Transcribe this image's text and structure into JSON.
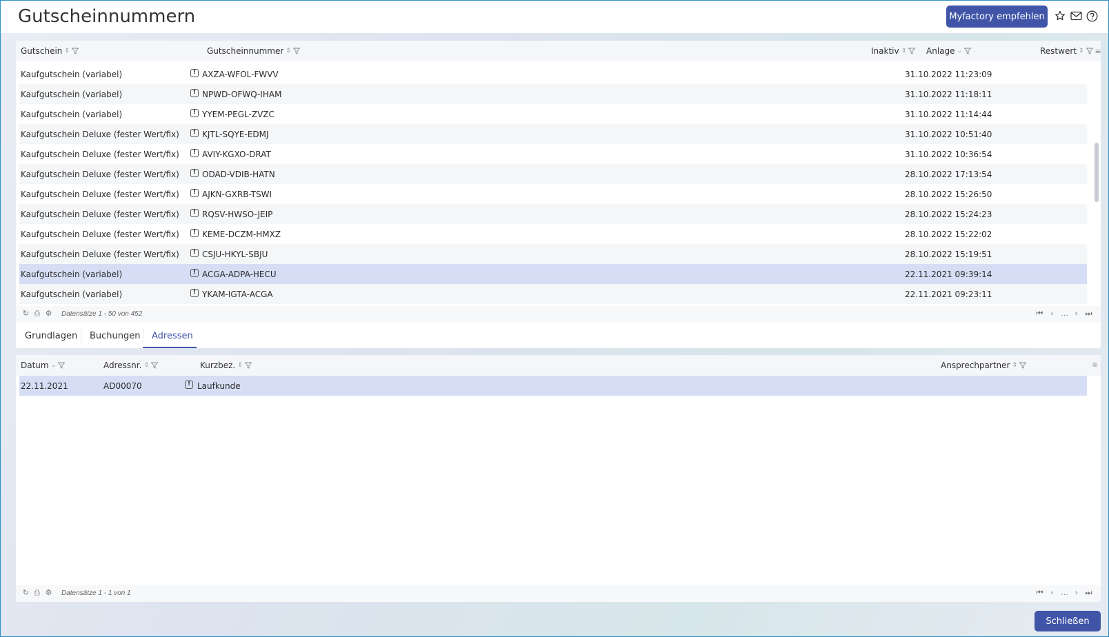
{
  "header": {
    "title": "Gutscheinnummern",
    "recommend_label": "Myfactory empfehlen",
    "icons": [
      "star-icon",
      "mail-icon",
      "help-icon"
    ]
  },
  "main_grid": {
    "columns": [
      "Gutschein",
      "Gutscheinnummer",
      "Inaktiv",
      "Anlage",
      "Restwert"
    ],
    "rows": [
      {
        "gutschein": "Kaufgutschein (variabel)",
        "nummer": "AXZA-WFOL-FWVV",
        "anlage": "31.10.2022 11:23:09"
      },
      {
        "gutschein": "Kaufgutschein (variabel)",
        "nummer": "NPWD-OFWQ-IHAM",
        "anlage": "31.10.2022 11:18:11"
      },
      {
        "gutschein": "Kaufgutschein (variabel)",
        "nummer": "YYEM-PEGL-ZVZC",
        "anlage": "31.10.2022 11:14:44"
      },
      {
        "gutschein": "Kaufgutschein Deluxe (fester Wert/fix)",
        "nummer": "KJTL-SQYE-EDMJ",
        "anlage": "31.10.2022 10:51:40"
      },
      {
        "gutschein": "Kaufgutschein Deluxe (fester Wert/fix)",
        "nummer": "AVIY-KGXO-DRAT",
        "anlage": "31.10.2022 10:36:54"
      },
      {
        "gutschein": "Kaufgutschein Deluxe (fester Wert/fix)",
        "nummer": "ODAD-VDIB-HATN",
        "anlage": "28.10.2022 17:13:54"
      },
      {
        "gutschein": "Kaufgutschein Deluxe (fester Wert/fix)",
        "nummer": "AJKN-GXRB-TSWI",
        "anlage": "28.10.2022 15:26:50"
      },
      {
        "gutschein": "Kaufgutschein Deluxe (fester Wert/fix)",
        "nummer": "RQSV-HWSO-JEIP",
        "anlage": "28.10.2022 15:24:23"
      },
      {
        "gutschein": "Kaufgutschein Deluxe (fester Wert/fix)",
        "nummer": "KEME-DCZM-HMXZ",
        "anlage": "28.10.2022 15:22:02"
      },
      {
        "gutschein": "Kaufgutschein Deluxe (fester Wert/fix)",
        "nummer": "CSJU-HKYL-SBJU",
        "anlage": "28.10.2022 15:19:51"
      },
      {
        "gutschein": "Kaufgutschein (variabel)",
        "nummer": "ACGA-ADPA-HECU",
        "anlage": "22.11.2021 09:39:14"
      },
      {
        "gutschein": "Kaufgutschein (variabel)",
        "nummer": "YKAM-IGTA-ACGA",
        "anlage": "22.11.2021 09:23:11"
      }
    ],
    "selected_index": 10,
    "footer_text": "Datensätze 1 - 50 von 452"
  },
  "tabs": [
    {
      "label": "Grundlagen"
    },
    {
      "label": "Buchungen"
    },
    {
      "label": "Adressen"
    }
  ],
  "active_tab": 2,
  "address_grid": {
    "columns": [
      "Datum",
      "Adressnr.",
      "Kurzbez.",
      "Ansprechpartner"
    ],
    "rows": [
      {
        "datum": "22.11.2021",
        "adressnr": "AD00070",
        "kurzbez": "Laufkunde"
      }
    ],
    "footer_text": "Datensätze 1 - 1 von 1"
  },
  "close_label": "Schließen",
  "colors": {
    "accent": "#4055a8",
    "selected_row": "#d6def5"
  }
}
